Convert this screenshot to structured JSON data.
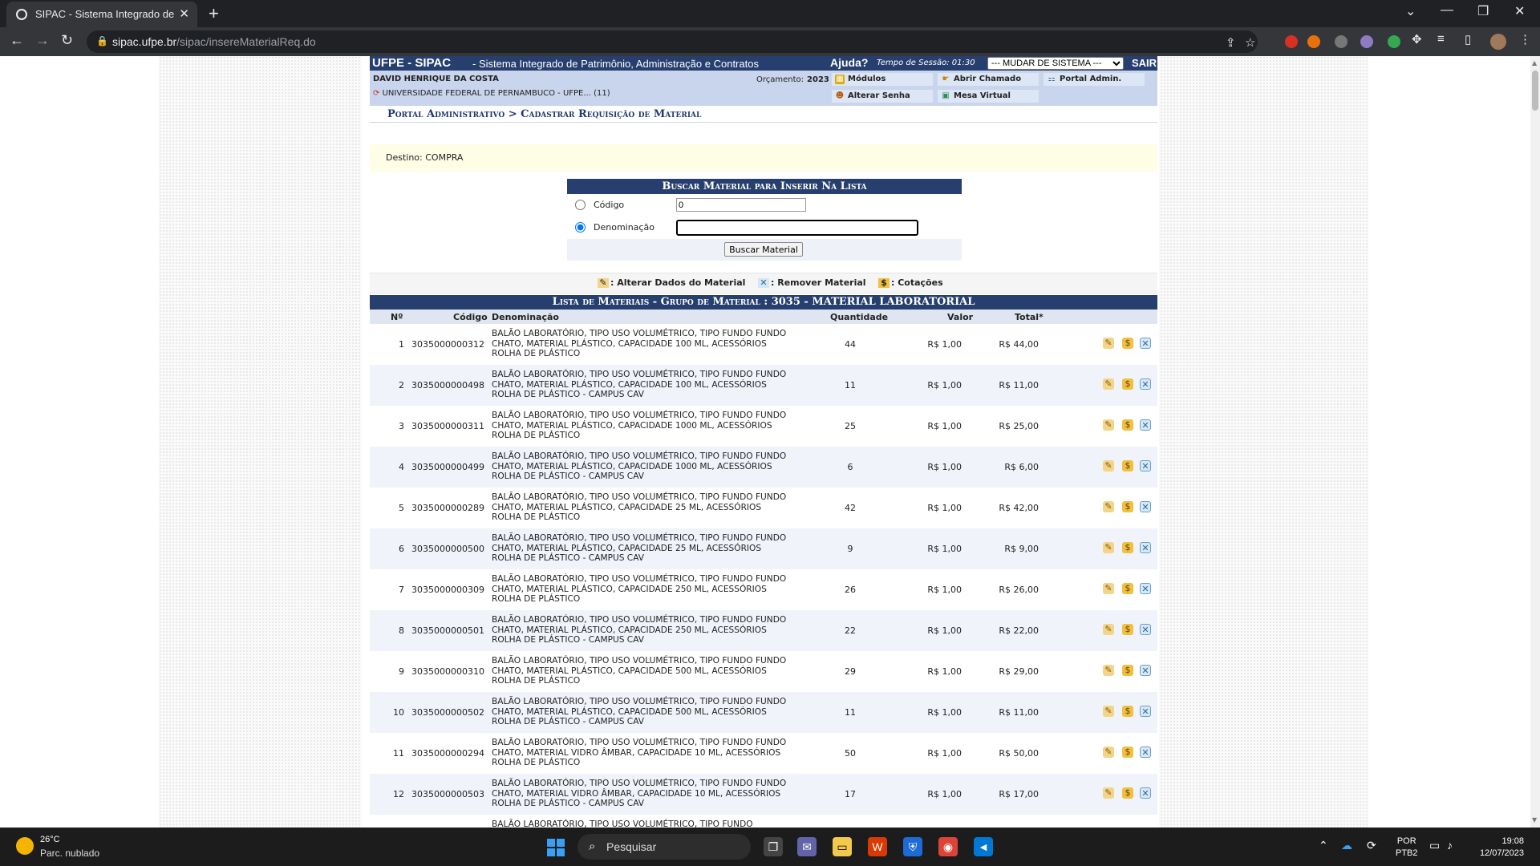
{
  "browser": {
    "tab_title": "SIPAC - Sistema Integrado de Pat",
    "tab_close": "✕",
    "new_tab": "+",
    "url_host": "sipac.ufpe.br",
    "url_path": "/sipac/insereMaterialReq.do"
  },
  "header": {
    "logo": "UFPE - SIPAC",
    "system_name": "- Sistema Integrado de Patrimônio, Administração e Contratos",
    "help": "Ajuda?",
    "session_time": "Tempo de Sessão: 01:30",
    "change_system": "--- MUDAR DE SISTEMA ---",
    "logout": "SAIR"
  },
  "user_info": {
    "name": "DAVID HENRIQUE DA COSTA",
    "unit": "UNIVERSIDADE FEDERAL DE PERNAMBUCO - UFPE... (11)",
    "budget_label": "Orçamento:",
    "budget_year": "2023"
  },
  "menu": {
    "modulos": "Módulos",
    "abrir_chamado": "Abrir Chamado",
    "portal_admin": "Portal Admin.",
    "alterar_senha": "Alterar Senha",
    "mesa_virtual": "Mesa Virtual"
  },
  "breadcrumb": "Portal Administrativo > Cadastrar Requisição de Material",
  "destino": "Destino: COMPRA",
  "search_form": {
    "caption": "Buscar Material para Inserir Na Lista",
    "codigo_label": "Código",
    "codigo_value": "0",
    "denominacao_label": "Denominação",
    "denominacao_value": "",
    "selected": "denominacao",
    "submit": "Buscar Material"
  },
  "legend": {
    "alterar": ": Alterar Dados do Material",
    "remover": ": Remover Material",
    "cotacoes": ": Cotações"
  },
  "list": {
    "caption": "Lista de Materiais - Grupo de Material : 3035 - MATERIAL LABORATORIAL",
    "columns": {
      "num": "Nº",
      "codigo": "Código",
      "denominacao": "Denominação",
      "quantidade": "Quantidade",
      "valor": "Valor",
      "total": "Total*"
    },
    "rows": [
      {
        "num": "1",
        "codigo": "3035000000312",
        "den": "BALÃO LABORATÓRIO, TIPO USO VOLUMÉTRICO, TIPO FUNDO FUNDO CHATO, MATERIAL PLÁSTICO, CAPACIDADE 100 ML, ACESSÓRIOS ROLHA DE PLÁSTICO",
        "qtd": "44",
        "valor": "R$ 1,00",
        "total": "R$ 44,00"
      },
      {
        "num": "2",
        "codigo": "3035000000498",
        "den": "BALÃO LABORATÓRIO, TIPO USO VOLUMÉTRICO, TIPO FUNDO FUNDO CHATO, MATERIAL PLÁSTICO, CAPACIDADE 100 ML, ACESSÓRIOS ROLHA DE PLÁSTICO - CAMPUS CAV",
        "qtd": "11",
        "valor": "R$ 1,00",
        "total": "R$ 11,00"
      },
      {
        "num": "3",
        "codigo": "3035000000311",
        "den": "BALÃO LABORATÓRIO, TIPO USO VOLUMÉTRICO, TIPO FUNDO FUNDO CHATO, MATERIAL PLÁSTICO, CAPACIDADE 1000 ML, ACESSÓRIOS ROLHA DE PLÁSTICO",
        "qtd": "25",
        "valor": "R$ 1,00",
        "total": "R$ 25,00"
      },
      {
        "num": "4",
        "codigo": "3035000000499",
        "den": "BALÃO LABORATÓRIO, TIPO USO VOLUMÉTRICO, TIPO FUNDO FUNDO CHATO, MATERIAL PLÁSTICO, CAPACIDADE 1000 ML, ACESSÓRIOS ROLHA DE PLÁSTICO - CAMPUS CAV",
        "qtd": "6",
        "valor": "R$ 1,00",
        "total": "R$ 6,00"
      },
      {
        "num": "5",
        "codigo": "3035000000289",
        "den": "BALÃO LABORATÓRIO, TIPO USO VOLUMÉTRICO, TIPO FUNDO FUNDO CHATO, MATERIAL PLÁSTICO, CAPACIDADE 25 ML, ACESSÓRIOS ROLHA DE PLÁSTICO",
        "qtd": "42",
        "valor": "R$ 1,00",
        "total": "R$ 42,00"
      },
      {
        "num": "6",
        "codigo": "3035000000500",
        "den": "BALÃO LABORATÓRIO, TIPO USO VOLUMÉTRICO, TIPO FUNDO FUNDO CHATO, MATERIAL PLÁSTICO, CAPACIDADE 25 ML, ACESSÓRIOS ROLHA DE PLÁSTICO - CAMPUS CAV",
        "qtd": "9",
        "valor": "R$ 1,00",
        "total": "R$ 9,00"
      },
      {
        "num": "7",
        "codigo": "3035000000309",
        "den": "BALÃO LABORATÓRIO, TIPO USO VOLUMÉTRICO, TIPO FUNDO FUNDO CHATO, MATERIAL PLÁSTICO, CAPACIDADE 250 ML, ACESSÓRIOS ROLHA DE PLÁSTICO",
        "qtd": "26",
        "valor": "R$ 1,00",
        "total": "R$ 26,00"
      },
      {
        "num": "8",
        "codigo": "3035000000501",
        "den": "BALÃO LABORATÓRIO, TIPO USO VOLUMÉTRICO, TIPO FUNDO FUNDO CHATO, MATERIAL PLÁSTICO, CAPACIDADE 250 ML, ACESSÓRIOS ROLHA DE PLÁSTICO - CAMPUS CAV",
        "qtd": "22",
        "valor": "R$ 1,00",
        "total": "R$ 22,00"
      },
      {
        "num": "9",
        "codigo": "3035000000310",
        "den": "BALÃO LABORATÓRIO, TIPO USO VOLUMÉTRICO, TIPO FUNDO FUNDO CHATO, MATERIAL PLÁSTICO, CAPACIDADE 500 ML, ACESSÓRIOS ROLHA DE PLÁSTICO",
        "qtd": "29",
        "valor": "R$ 1,00",
        "total": "R$ 29,00"
      },
      {
        "num": "10",
        "codigo": "3035000000502",
        "den": "BALÃO LABORATÓRIO, TIPO USO VOLUMÉTRICO, TIPO FUNDO FUNDO CHATO, MATERIAL PLÁSTICO, CAPACIDADE 500 ML, ACESSÓRIOS ROLHA DE PLÁSTICO - CAMPUS CAV",
        "qtd": "11",
        "valor": "R$ 1,00",
        "total": "R$ 11,00"
      },
      {
        "num": "11",
        "codigo": "3035000000294",
        "den": "BALÃO LABORATÓRIO, TIPO USO VOLUMÉTRICO, TIPO FUNDO FUNDO CHATO, MATERIAL VIDRO ÂMBAR, CAPACIDADE 10 ML, ACESSÓRIOS ROLHA DE PLÁSTICO",
        "qtd": "50",
        "valor": "R$ 1,00",
        "total": "R$ 50,00"
      },
      {
        "num": "12",
        "codigo": "3035000000503",
        "den": "BALÃO LABORATÓRIO, TIPO USO VOLUMÉTRICO, TIPO FUNDO FUNDO CHATO, MATERIAL VIDRO ÂMBAR, CAPACIDADE 10 ML, ACESSÓRIOS ROLHA DE PLÁSTICO - CAMPUS CAV",
        "qtd": "17",
        "valor": "R$ 1,00",
        "total": "R$ 17,00"
      },
      {
        "num": "",
        "codigo": "",
        "den": "BALÃO LABORATÓRIO, TIPO USO VOLUMÉTRICO, TIPO FUNDO",
        "qtd": "",
        "valor": "",
        "total": ""
      }
    ]
  },
  "taskbar": {
    "temperature": "26°C",
    "condition": "Parc. nublado",
    "search_placeholder": "Pesquisar",
    "lang_line1": "POR",
    "lang_line2": "PTB2",
    "time": "19:08",
    "date": "12/07/2023"
  }
}
